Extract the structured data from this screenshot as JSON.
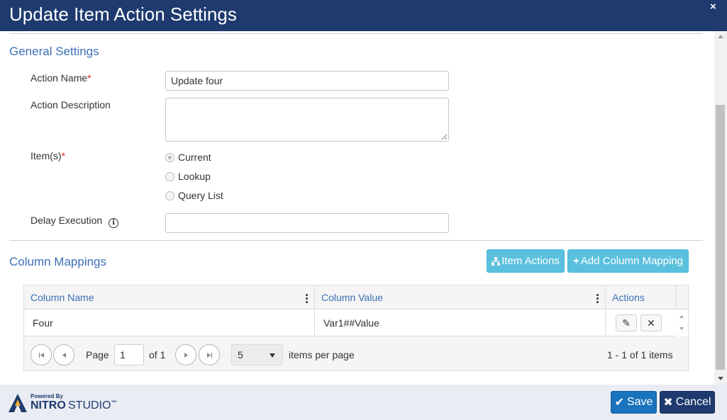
{
  "dialog": {
    "title": "Update Item Action Settings",
    "close_glyph": "×"
  },
  "general": {
    "section_title": "General Settings",
    "action_name": {
      "label": "Action Name",
      "required_mark": "*",
      "value": "Update four"
    },
    "action_description": {
      "label": "Action Description",
      "value": ""
    },
    "items": {
      "label": "Item(s)",
      "required_mark": "*",
      "options": [
        {
          "label": "Current",
          "checked": true
        },
        {
          "label": "Lookup",
          "checked": false
        },
        {
          "label": "Query List",
          "checked": false
        }
      ]
    },
    "delay_execution": {
      "label": "Delay Execution",
      "icon": "info-icon",
      "info_glyph": "i",
      "value": ""
    }
  },
  "mappings": {
    "section_title": "Column Mappings",
    "item_actions_button": {
      "label": "Item Actions",
      "icon": "sitemap-icon"
    },
    "add_mapping_button": {
      "label": "Add Column Mapping",
      "icon": "plus-icon",
      "icon_glyph": "+"
    },
    "grid": {
      "columns": [
        "Column Name",
        "Column Value",
        "Actions"
      ],
      "rows": [
        {
          "column_name": "Four",
          "column_value": "Var1##Value"
        }
      ],
      "row_actions": [
        {
          "icon": "pencil-icon",
          "glyph": "✎"
        },
        {
          "icon": "close-icon",
          "glyph": "✕"
        }
      ],
      "pager": {
        "page_label": "Page",
        "page_value": "1",
        "of_label": "of 1",
        "page_size": "5",
        "items_per_page_label": "items per page",
        "summary": "1 - 1 of 1 items"
      }
    }
  },
  "footer": {
    "logo_powered": "Powered By",
    "logo_nitro": "NITRO",
    "logo_studio": "STUDIO",
    "logo_tm": "™",
    "save_button": {
      "label": "Save",
      "icon": "check-icon",
      "glyph": "✔"
    },
    "cancel_button": {
      "label": "Cancel",
      "icon": "close-icon",
      "glyph": "✖"
    }
  },
  "colors": {
    "title_bar": "#1e3a6e",
    "section_title": "#3d6fb6",
    "info_button": "#5bc0de",
    "save_button": "#1a73bd",
    "cancel_button": "#1e3a6e",
    "required": "#d9262b"
  }
}
